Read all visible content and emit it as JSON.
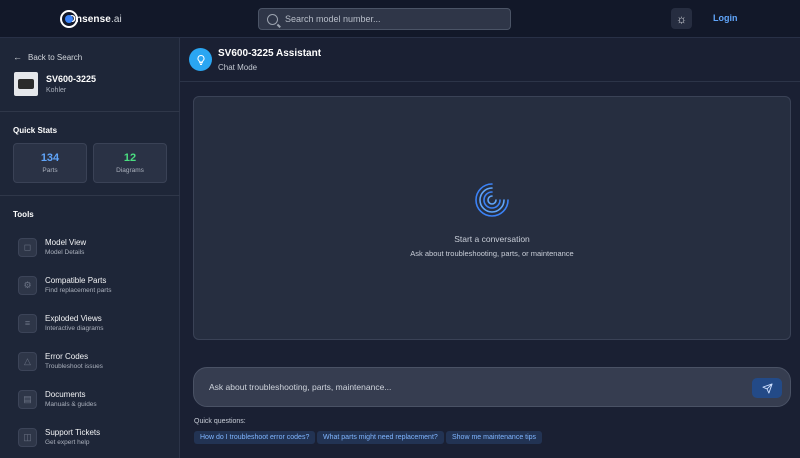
{
  "header": {
    "logo_main": "Onsense",
    "logo_suffix": ".ai",
    "search_placeholder": "Search model number...",
    "theme_icon": "sun-icon",
    "login_label": "Login"
  },
  "sidebar": {
    "back_label": "Back to Search",
    "model_number": "SV600-3225",
    "brand": "Kohler",
    "quick_stats_title": "Quick Stats",
    "stats": [
      {
        "value": "134",
        "label": "Parts",
        "color": "#60a5fa"
      },
      {
        "value": "12",
        "label": "Diagrams",
        "color": "#4ade80"
      }
    ],
    "tools_title": "Tools",
    "tools": [
      {
        "title": "Model View",
        "subtitle": "Model Details",
        "icon": "cube-icon"
      },
      {
        "title": "Compatible Parts",
        "subtitle": "Find replacement parts",
        "icon": "gear-icon"
      },
      {
        "title": "Exploded Views",
        "subtitle": "Interactive diagrams",
        "icon": "layers-icon"
      },
      {
        "title": "Error Codes",
        "subtitle": "Troubleshoot issues",
        "icon": "warning-icon"
      },
      {
        "title": "Documents",
        "subtitle": "Manuals & guides",
        "icon": "document-icon"
      },
      {
        "title": "Support Tickets",
        "subtitle": "Get expert help",
        "icon": "ticket-icon"
      }
    ]
  },
  "main": {
    "assistant_title": "SV600-3225 Assistant",
    "assistant_mode": "Chat Mode",
    "assistant_icon": "lightbulb-icon",
    "empty_title": "Start a conversation",
    "empty_subtitle": "Ask about troubleshooting, parts, or maintenance",
    "composer_placeholder": "Ask about troubleshooting, parts, maintenance...",
    "send_icon": "send-icon",
    "quick_questions_label": "Quick questions:",
    "quick_questions": [
      "How do I troubleshoot error codes?",
      "What parts might need replacement?",
      "Show me maintenance tips"
    ]
  },
  "colors": {
    "accent": "#60a5fa",
    "assistant_avatar": "#2aa6f2",
    "send_button": "#234a87"
  }
}
